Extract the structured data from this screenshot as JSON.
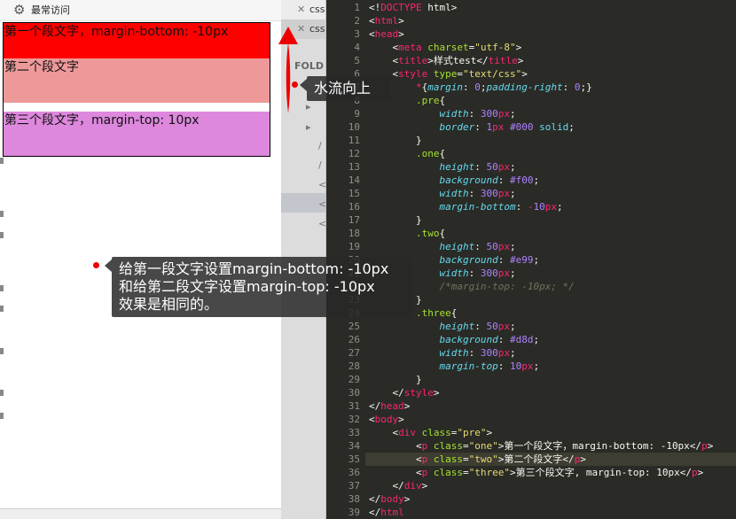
{
  "browser": {
    "bookmark_label": "最常访问",
    "paragraphs": [
      "第一个段文字，margin-bottom: -10px",
      "第二个段文字",
      "第三个段文字，margin-top: 10px"
    ]
  },
  "editor": {
    "tabs": [
      "css",
      "css"
    ],
    "folders_label": "FOLD",
    "line_numbers": [
      "1",
      "2",
      "3",
      "4",
      "5",
      "6",
      "7",
      "8",
      "9",
      "10",
      "11",
      "12",
      "13",
      "14",
      "15",
      "16",
      "17",
      "18",
      "19",
      "20",
      "21",
      "22",
      "23",
      "24",
      "25",
      "26",
      "27",
      "28",
      "29",
      "30",
      "31",
      "32",
      "33",
      "34",
      "35",
      "36",
      "37",
      "38",
      "39"
    ]
  },
  "annotations": {
    "arrow_tip": "水流向上",
    "note_line1": "给第一段文字设置margin-bottom: -10px",
    "note_line2": "和给第二段文字设置margin-top: -10px",
    "note_line3": "效果是相同的。"
  },
  "colors": {
    "one": "#f00",
    "two": "#e99",
    "three": "#d8d",
    "annotation_red": "#e00"
  }
}
